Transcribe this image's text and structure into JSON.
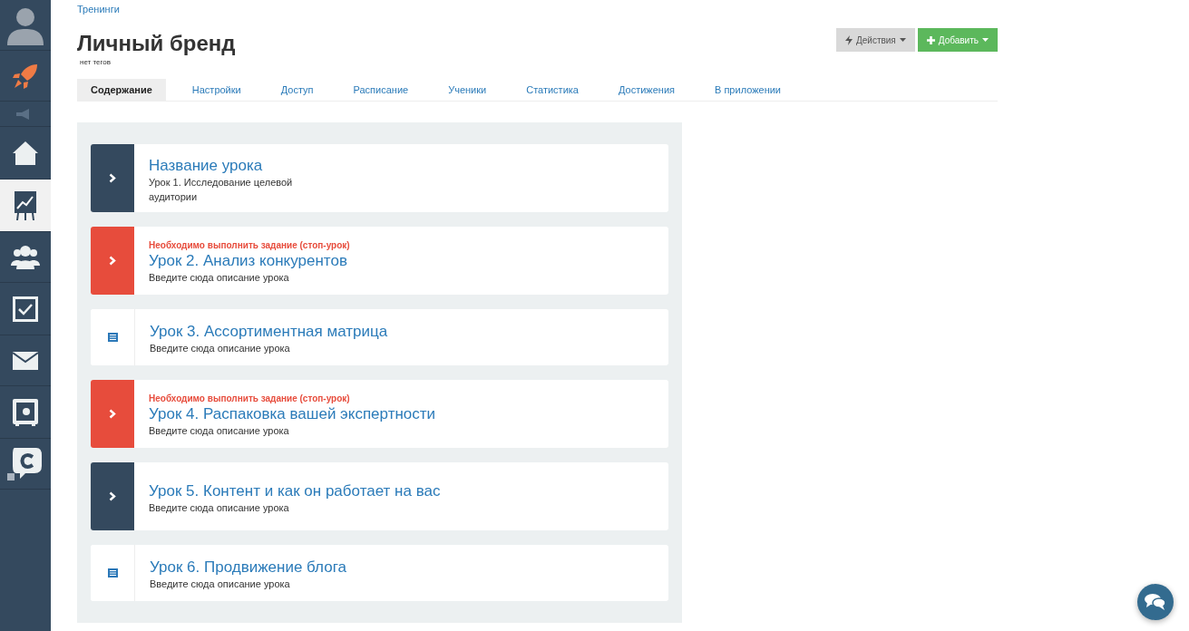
{
  "sidebar": {
    "items": [
      {
        "kind": "avatar",
        "selected": false
      },
      {
        "kind": "rocket",
        "selected": false
      },
      {
        "kind": "megaphone",
        "selected": false
      },
      {
        "kind": "home",
        "selected": false
      },
      {
        "kind": "chart",
        "selected": true
      },
      {
        "kind": "people",
        "selected": false
      },
      {
        "kind": "check",
        "selected": false
      },
      {
        "kind": "mail",
        "selected": false
      },
      {
        "kind": "safe",
        "selected": false
      },
      {
        "kind": "chat",
        "selected": false
      }
    ]
  },
  "breadcrumb": "Тренинги",
  "title": "Личный бренд",
  "tags": "нет тегов",
  "buttons": [
    {
      "kind": "actions",
      "label": "Действия"
    },
    {
      "kind": "add",
      "label": "Добавить"
    }
  ],
  "tabs": [
    {
      "label": "Содержание",
      "selected": true
    },
    {
      "label": "Настройки",
      "selected": false
    },
    {
      "label": "Доступ",
      "selected": false
    },
    {
      "label": "Расписание",
      "selected": false
    },
    {
      "label": "Ученики",
      "selected": false
    },
    {
      "label": "Статистика",
      "selected": false
    },
    {
      "label": "Достижения",
      "selected": false
    },
    {
      "label": "В приложении",
      "selected": false
    }
  ],
  "lessons": [
    {
      "kind": "module",
      "title": "Название урока",
      "description": "Урок 1. Исследование целевой аудитории"
    },
    {
      "kind": "stop",
      "warning": "Необходимо выполнить задание (стоп-урок)",
      "title": "Урок 2. Анализ конкурентов",
      "description": "Введите сюда описание урока"
    },
    {
      "kind": "text",
      "title": "Урок 3. Ассортиментная матрица",
      "description": "Введите сюда описание урока"
    },
    {
      "kind": "stop",
      "warning": "Необходимо выполнить задание (стоп-урок)",
      "title": "Урок 4. Распаковка вашей экспертности",
      "description": "Введите сюда описание урока"
    },
    {
      "kind": "module",
      "title": "Урок 5. Контент и как он работает на вас",
      "description": "Введите сюда описание урока"
    },
    {
      "kind": "text",
      "title": "Урок 6. Продвижение блога",
      "description": "Введите сюда описание урока"
    }
  ]
}
